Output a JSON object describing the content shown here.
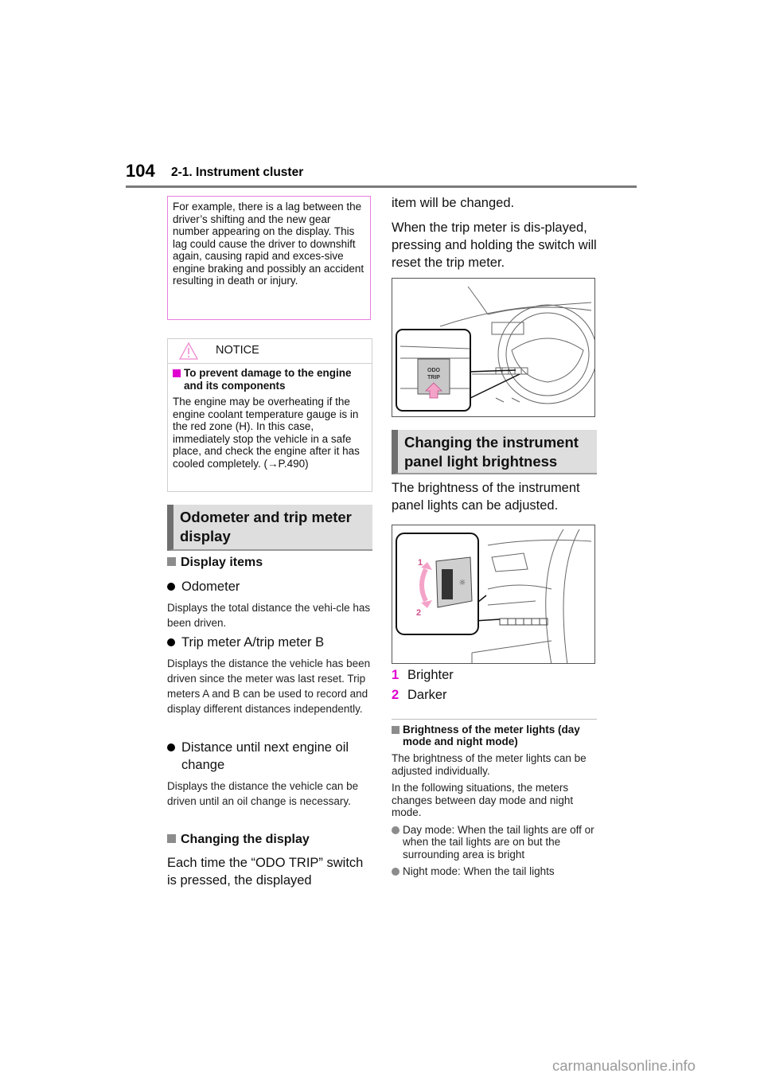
{
  "header": {
    "page_number": "104",
    "chapter": "2-1. Instrument cluster"
  },
  "warning_continuation": {
    "text": "For example, there is a lag between the driver’s shifting and the new gear number appearing on the display. This lag could cause the driver to downshift again, causing rapid and exces-sive engine braking and possibly an accident resulting in death or injury."
  },
  "notice": {
    "label": "NOTICE",
    "icon": "warning-triangle-icon",
    "subheading": "To prevent damage to the engine and its components",
    "body": "The engine may be overheating if the engine coolant temperature gauge is in the red zone (H). In this case, immediately stop the vehicle in a safe place, and check the engine after it has cooled completely. (→P.490)"
  },
  "odometer_section": {
    "title": "Odometer and trip meter display",
    "display_items_heading": "Display items",
    "items": [
      {
        "label": "Odometer",
        "desc": "Displays the total distance the vehi-cle has been driven."
      },
      {
        "label": "Trip meter A/trip meter B",
        "desc": "Displays the distance the vehicle has been driven since the meter was last reset. Trip meters A and B can be used to record and display different distances independently."
      },
      {
        "label": "Distance until next engine oil change",
        "desc": "Displays the distance the vehicle can be driven until an oil change is necessary."
      }
    ],
    "changing_heading": "Changing the display",
    "changing_text": "Each time the “ODO TRIP” switch is pressed, the displayed item will be changed.",
    "changing_text_left": "Each time the “ODO TRIP” switch is pressed, the displayed",
    "changing_text_right": "item will be changed.",
    "reset_text": "When the trip meter is dis-played, pressing and holding the switch will reset the trip meter.",
    "figure_label_line1": "ODO",
    "figure_label_line2": "TRIP"
  },
  "brightness_section": {
    "title": "Changing the instrument panel light brightness",
    "intro": "The brightness of the instrument panel lights can be adjusted.",
    "figure_labels": [
      "1",
      "2"
    ],
    "legend": [
      {
        "num": "1",
        "label": "Brighter"
      },
      {
        "num": "2",
        "label": "Darker"
      }
    ],
    "meter_heading": "Brightness of the meter lights (day mode and night mode)",
    "meter_text1": "The brightness of the meter lights can be adjusted individually.",
    "meter_text2": "In the following situations, the meters changes between day mode and night mode.",
    "modes": [
      "Day mode: When the tail lights are off or when the tail lights are on but the surrounding area is bright",
      "Night mode: When the tail lights"
    ]
  },
  "colors": {
    "accent_magenta": "#e000d0",
    "warning_border": "#e87ee0",
    "section_bg": "#dedede"
  },
  "watermark": "carmanualsonline.info"
}
